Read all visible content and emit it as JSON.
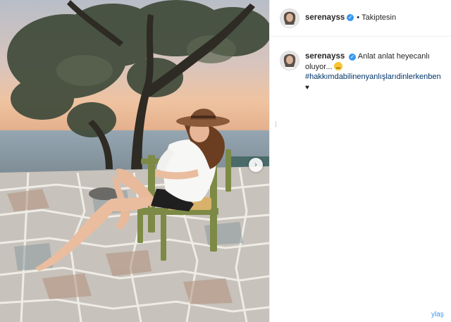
{
  "post": {
    "username": "serenayss",
    "follow_label": "Takiptesin",
    "separator": "•",
    "caption_text": "Anlat anlat heyecanlı oluyor...",
    "hashtag": "#hakkımdabilinenyanlışlarıdinlerkenben",
    "heart": "♥"
  },
  "photo": {
    "next_arrow": "›",
    "alt": "woman in hat sitting on a wooden chair on a stone terrace at sunset"
  },
  "footer": {
    "overflow_text": "ylaş"
  },
  "colors": {
    "link_blue": "#3897f0",
    "hashtag_blue": "#003569",
    "text": "#262626",
    "border": "#efefef"
  }
}
